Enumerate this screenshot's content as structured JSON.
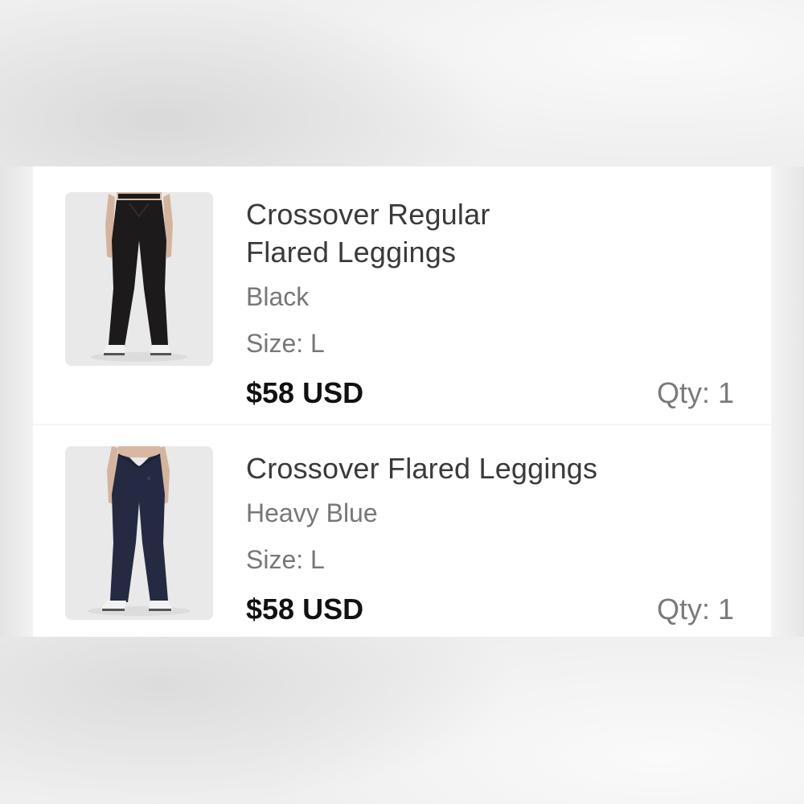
{
  "cart": {
    "items": [
      {
        "name_line1": "Crossover Regular",
        "name_line2": "Flared Leggings",
        "color": "Black",
        "size": "Size: L",
        "price": "$58 USD",
        "qty": "Qty: 1",
        "image_icon": "product-photo-black-leggings",
        "swatch": "#1c1a1b"
      },
      {
        "name_line1": "Crossover Flared Leggings",
        "color": "Heavy Blue",
        "size": "Size: L",
        "price": "$58 USD",
        "qty": "Qty: 1",
        "image_icon": "product-photo-navy-leggings",
        "swatch": "#232a42"
      }
    ]
  }
}
